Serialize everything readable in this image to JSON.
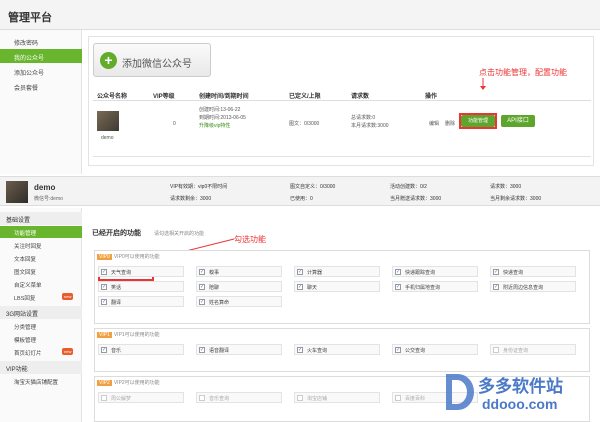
{
  "app": {
    "title": "管理平台"
  },
  "sidebar_top": {
    "items": [
      {
        "label": "修改密码",
        "active": false
      },
      {
        "label": "我的公众号",
        "active": true
      },
      {
        "label": "添加公众号",
        "active": false
      },
      {
        "label": "会员套餐",
        "active": false
      }
    ]
  },
  "account_list": {
    "add_button": "添加微信公众号",
    "columns": [
      "公众号名称",
      "VIP等级",
      "创建时间/到期时间",
      "已定义/上限",
      "请求数",
      "操作"
    ],
    "row": {
      "name": "demo",
      "vip": "0",
      "created": "创建时间:13-06-22",
      "expires": "到期时间:2013-06-05",
      "upgrade": "升降级vip特性",
      "defined": "图文：0/3000",
      "requests_total": "总请求数:0",
      "requests_month": "本月请求数:3000",
      "edit": "编辑",
      "delete": "删除",
      "func_button": "功能管理",
      "api_button": "API接口"
    },
    "annotation": "点击功能管理，配置功能"
  },
  "profile": {
    "name": "demo",
    "sub": "微信号:demo",
    "stats": [
      [
        "VIP有效期：vip0不限时间",
        "请求数剩余：3000"
      ],
      [
        "图文自定义：0/3000",
        "已使用：0"
      ],
      [
        "活动创建数：0/2",
        "当月赠送请求数：3000"
      ],
      [
        "请求数：3000",
        "当月剩余请求数：3000"
      ]
    ]
  },
  "sidebar_bottom": {
    "groups": [
      {
        "head": "基础设置",
        "items": [
          {
            "label": "功能管理",
            "active": true
          },
          {
            "label": "关注时回复",
            "active": false
          },
          {
            "label": "文本回复",
            "active": false
          },
          {
            "label": "图文回复",
            "active": false
          },
          {
            "label": "自定义菜单",
            "active": false
          },
          {
            "label": "LBS回复",
            "active": false,
            "badge": "new"
          }
        ]
      },
      {
        "head": "3G网站设置",
        "items": [
          {
            "label": "分类管理",
            "active": false
          },
          {
            "label": "模板管理",
            "active": false
          },
          {
            "label": "首页幻灯片",
            "active": false,
            "badge": "new"
          }
        ]
      },
      {
        "head": "VIP功能",
        "items": [
          {
            "label": "淘宝天猫店铺配置",
            "active": false
          }
        ]
      }
    ]
  },
  "functions": {
    "title": "已经开启的功能",
    "subtitle": "请勾选相关开启的功能",
    "annotation": "勾选功能",
    "groups": [
      {
        "tag": "VIP0",
        "label": "VIP0可以使用的功能",
        "items": [
          {
            "label": "天气查询",
            "checked": true
          },
          {
            "label": "糗事",
            "checked": true
          },
          {
            "label": "计算器",
            "checked": true
          },
          {
            "label": "快递跟踪查询",
            "checked": true
          },
          {
            "label": "快递查询",
            "checked": true
          },
          {
            "label": "笑话",
            "checked": true
          },
          {
            "label": "陪聊",
            "checked": true
          },
          {
            "label": "聊天",
            "checked": true
          },
          {
            "label": "手机归属地查询",
            "checked": true
          },
          {
            "label": "附近周边信息查询",
            "checked": true
          },
          {
            "label": "翻译",
            "checked": true
          },
          {
            "label": "姓名算命",
            "checked": true
          }
        ]
      },
      {
        "tag": "VIP1",
        "label": "VIP1可以使用的功能",
        "items": [
          {
            "label": "音乐",
            "checked": true
          },
          {
            "label": "语音翻译",
            "checked": true
          },
          {
            "label": "火车查询",
            "checked": true
          },
          {
            "label": "公交查询",
            "checked": true
          },
          {
            "label": "身份证查询",
            "checked": false,
            "disabled": true
          }
        ]
      },
      {
        "tag": "VIP2",
        "label": "VIP2可以使用的功能",
        "items": [
          {
            "label": "周公解梦",
            "checked": false,
            "disabled": true
          },
          {
            "label": "音乐查询",
            "checked": false,
            "disabled": true
          },
          {
            "label": "淘宝店铺",
            "checked": false,
            "disabled": true
          },
          {
            "label": "百度百科",
            "checked": false,
            "disabled": true
          }
        ]
      }
    ]
  },
  "watermark": {
    "brand": "多多软件站",
    "url": "ddooo.com"
  },
  "colors": {
    "accent_green": "#5da52c",
    "annotation_red": "#ee3333",
    "watermark_blue": "#4a79c7"
  }
}
